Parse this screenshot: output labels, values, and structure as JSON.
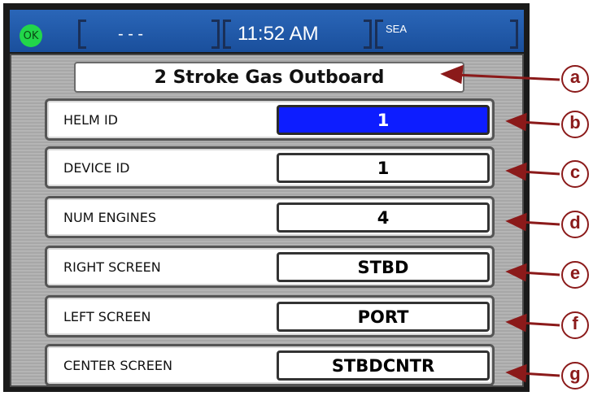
{
  "status": {
    "ok_label": "OK",
    "left_field": "- - -",
    "time": "11:52 AM",
    "mode": "SEA"
  },
  "title": "2 Stroke Gas Outboard",
  "rows": [
    {
      "label": "HELM ID",
      "value": "1",
      "selected": true
    },
    {
      "label": "DEVICE ID",
      "value": "1"
    },
    {
      "label": "NUM  ENGINES",
      "value": "4"
    },
    {
      "label": "RIGHT  SCREEN",
      "value": "STBD"
    },
    {
      "label": "LEFT  SCREEN",
      "value": "PORT"
    },
    {
      "label": "CENTER  SCREEN",
      "value": "STBDCNTR"
    }
  ],
  "callouts": [
    "a",
    "b",
    "c",
    "d",
    "e",
    "f",
    "g"
  ],
  "colors": {
    "status_bar": "#1a4f9c",
    "ok_indicator": "#22d64a",
    "selected_field": "#0d1dff",
    "callout": "#8b1a1a"
  }
}
